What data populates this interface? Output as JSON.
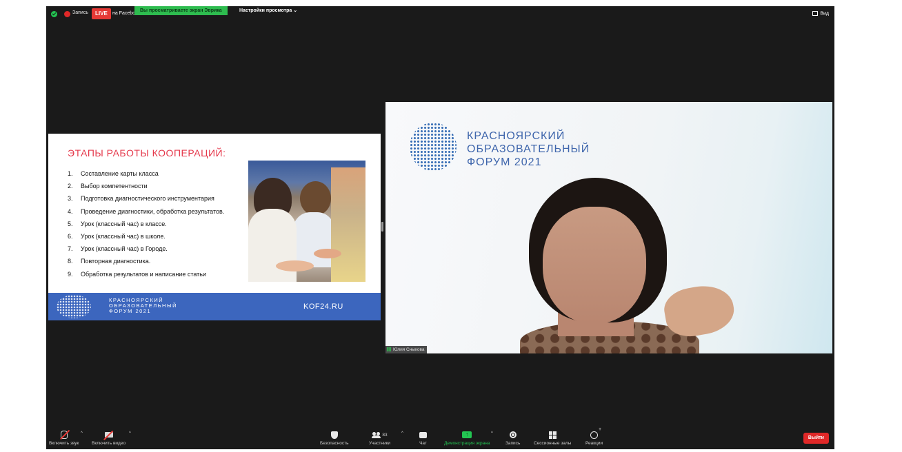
{
  "top_bar": {
    "record_label": "Запись",
    "live_badge": "LIVE",
    "live_target": "на Facebook",
    "viewing_banner": "Вы просматриваете экран Эврика",
    "view_settings": "Настройки просмотра",
    "view_button": "Вид"
  },
  "slide": {
    "title": "ЭТАПЫ РАБОТЫ КООПЕРАЦИЙ:",
    "items": [
      {
        "num": "1.",
        "text": "Составление карты класса"
      },
      {
        "num": "2.",
        "text": "Выбор компетентности"
      },
      {
        "num": "3.",
        "text": "Подготовка диагностического инструментария"
      },
      {
        "num": "4.",
        "text": "Проведение диагностики, обработка результатов."
      },
      {
        "num": "5.",
        "text": "Урок (классный час) в классе."
      },
      {
        "num": "6.",
        "text": "Урок (классный час) в школе."
      },
      {
        "num": "7.",
        "text": "Урок (классный час) в Городе."
      },
      {
        "num": "8.",
        "text": "Повторная диагностика."
      },
      {
        "num": "9.",
        "text": "Обработка результатов и написание статьи"
      }
    ],
    "footer_forum": [
      "КРАСНОЯРСКИЙ",
      "ОБРАЗОВАТЕЛЬНЫЙ",
      "ФОРУМ 2021"
    ],
    "footer_site": "KOF24.RU"
  },
  "video": {
    "forum_logo": [
      "КРАСНОЯРСКИЙ",
      "ОБРАЗОВАТЕЛЬНЫЙ",
      "ФОРУМ 2021"
    ],
    "participant_name": "Юлия Сныкова"
  },
  "toolbar": {
    "audio": "Включить звук",
    "video": "Включить видео",
    "security": "Безопасность",
    "participants": "Участники",
    "participants_count": "83",
    "chat": "Чат",
    "share_screen": "Демонстрация экрана",
    "record": "Запись",
    "breakout": "Сессионные залы",
    "reactions": "Реакции",
    "leave": "Выйти"
  },
  "colors": {
    "accent_green": "#2ebc4f",
    "live_red": "#e53935",
    "slide_title_red": "#e5374a",
    "forum_blue": "#3c66be"
  }
}
